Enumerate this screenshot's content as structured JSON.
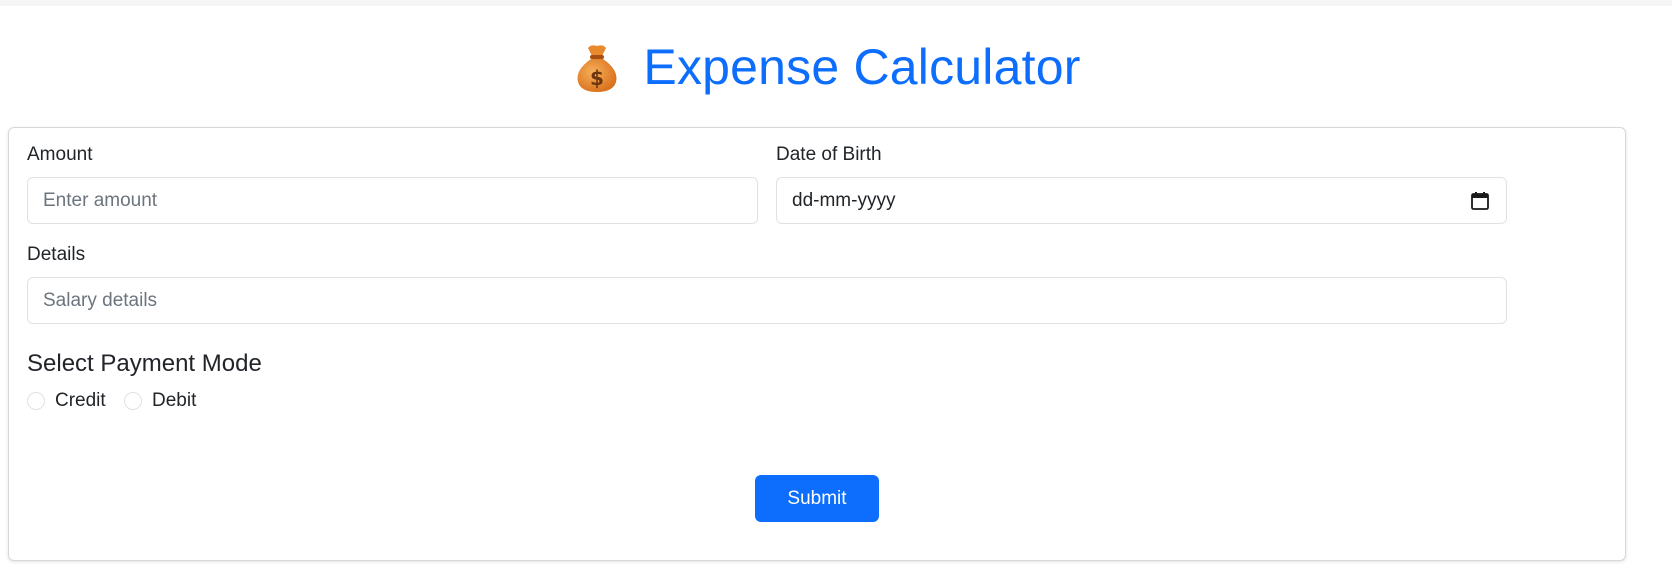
{
  "header": {
    "icon": "money-bag-icon",
    "title": "Expense Calculator"
  },
  "form": {
    "amount": {
      "label": "Amount",
      "placeholder": "Enter amount",
      "value": ""
    },
    "date_of_birth": {
      "label": "Date of Birth",
      "display": "dd-mm-yyyy",
      "icon": "calendar-icon"
    },
    "details": {
      "label": "Details",
      "placeholder": "Salary details",
      "value": ""
    },
    "payment_mode": {
      "heading": "Select Payment Mode",
      "options": [
        {
          "label": "Credit",
          "selected": false
        },
        {
          "label": "Debit",
          "selected": false
        }
      ]
    },
    "submit_label": "Submit"
  },
  "colors": {
    "primary": "#0d6efd",
    "text": "#212529",
    "placeholder": "#6c757d",
    "border": "#dee2e6"
  }
}
